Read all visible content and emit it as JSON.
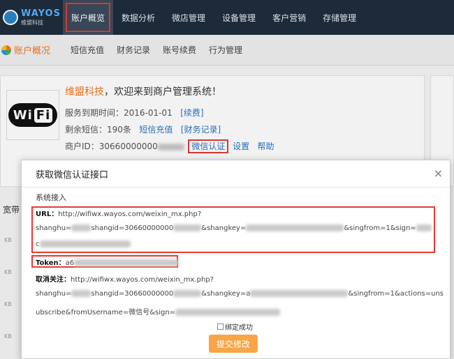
{
  "logo": {
    "name": "WAYOS",
    "sub": "维盟科技"
  },
  "nav": {
    "items": [
      "账户概览",
      "数据分析",
      "微店管理",
      "设备管理",
      "客户营销",
      "存储管理"
    ]
  },
  "subnav": {
    "home": "账户概况",
    "items": [
      "短信充值",
      "财务记录",
      "账号续费",
      "行为管理"
    ]
  },
  "account": {
    "brand": "维盟科技",
    "welcome": "，欢迎来到商户管理系统！",
    "wifi_logo": "Wi Fi",
    "expire_label": "服务到期时间：",
    "expire_date": "2016-01-01",
    "renew": "[续费]",
    "sms_label": "剩余短信：",
    "sms_count": "190条",
    "sms_recharge": "短信充值",
    "finance": "[财务记录]",
    "merchant_id_label": "商户ID：",
    "merchant_id": "30660000000",
    "wechat_auth": "微信认证",
    "settings": "设置",
    "help": "帮助"
  },
  "left": {
    "broadband": "宽带",
    "kb": "KB"
  },
  "modal": {
    "title": "获取微信认证接口",
    "close": "×",
    "section": "系统接入",
    "url_label": "URL：",
    "url_value": "http://wifiwx.wayos.com/weixin_mx.php?",
    "url_line2_a": "shanghu=",
    "url_line2_b": "shangid=30660000000",
    "url_line2_c": "&shangkey=",
    "url_line2_d": "&singfrom=1&sign=",
    "url_line3": "c",
    "token_label": "Token：",
    "token_value": "a6",
    "unsub_label": "取消关注：",
    "unsub_value": "http://wifiwx.wayos.com/weixin_mx.php?",
    "unsub_line2_a": "shanghu=",
    "unsub_line2_b": "shangid=30660000000",
    "unsub_line2_c": "&shangkey=a",
    "unsub_line2_d": "&singfrom=1&actions=uns",
    "unsub_line3_a": "ubscribe&fromUsername=微信号&sign=",
    "bind_label": "绑定成功",
    "submit": "提交修改"
  }
}
